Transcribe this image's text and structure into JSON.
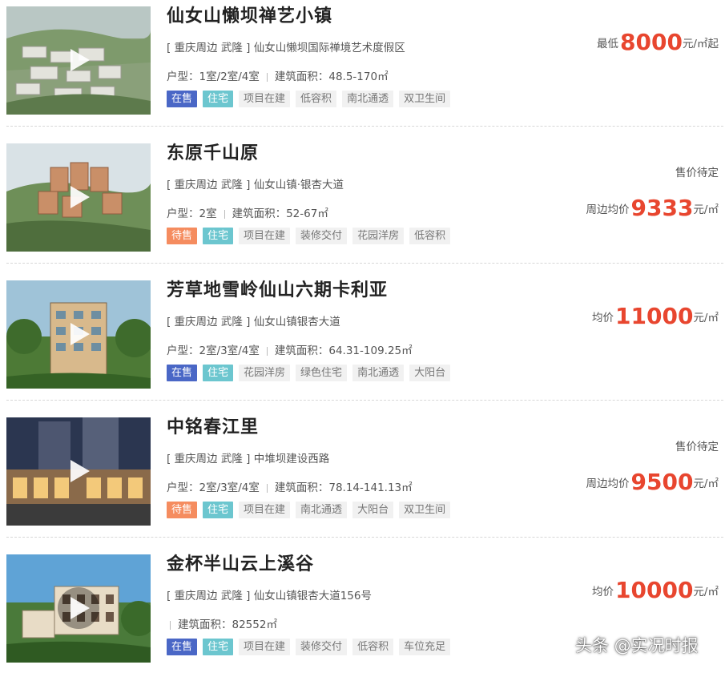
{
  "listings": [
    {
      "title": "仙女山懒坝禅艺小镇",
      "address": "[ 重庆周边 武隆 ] 仙女山懒坝国际禅境艺术度假区",
      "layout_label": "户型：",
      "layout_value": "1室/2室/4室",
      "area_label": "建筑面积：",
      "area_value": "48.5-170㎡",
      "status_tag": "在售",
      "type_tag": "住宅",
      "features": [
        "项目在建",
        "低容积",
        "南北通透",
        "双卫生间"
      ],
      "price_prefix": "最低",
      "price_value": "8000",
      "price_unit": "元/㎡起",
      "pending": ""
    },
    {
      "title": "东原千山原",
      "address": "[ 重庆周边 武隆 ] 仙女山镇·银杏大道",
      "layout_label": "户型：",
      "layout_value": "2室",
      "area_label": "建筑面积：",
      "area_value": "52-67㎡",
      "status_tag": "待售",
      "type_tag": "住宅",
      "features": [
        "项目在建",
        "装修交付",
        "花园洋房",
        "低容积"
      ],
      "price_prefix": "周边均价",
      "price_value": "9333",
      "price_unit": "元/㎡",
      "pending": "售价待定"
    },
    {
      "title": "芳草地雪岭仙山六期卡利亚",
      "address": "[ 重庆周边 武隆 ] 仙女山镇银杏大道",
      "layout_label": "户型：",
      "layout_value": "2室/3室/4室",
      "area_label": "建筑面积：",
      "area_value": "64.31-109.25㎡",
      "status_tag": "在售",
      "type_tag": "住宅",
      "features": [
        "花园洋房",
        "绿色住宅",
        "南北通透",
        "大阳台"
      ],
      "price_prefix": "均价",
      "price_value": "11000",
      "price_unit": "元/㎡",
      "pending": ""
    },
    {
      "title": "中铭春江里",
      "address": "[ 重庆周边 武隆 ] 中堆坝建设西路",
      "layout_label": "户型：",
      "layout_value": "2室/3室/4室",
      "area_label": "建筑面积：",
      "area_value": "78.14-141.13㎡",
      "status_tag": "待售",
      "type_tag": "住宅",
      "features": [
        "项目在建",
        "南北通透",
        "大阳台",
        "双卫生间"
      ],
      "price_prefix": "周边均价",
      "price_value": "9500",
      "price_unit": "元/㎡",
      "pending": "售价待定"
    },
    {
      "title": "金杯半山云上溪谷",
      "address": "[ 重庆周边 武隆 ] 仙女山镇银杏大道156号",
      "layout_label": "",
      "layout_value": "",
      "area_label": "建筑面积：",
      "area_value": "82552㎡",
      "status_tag": "在售",
      "type_tag": "住宅",
      "features": [
        "项目在建",
        "装修交付",
        "低容积",
        "车位充足"
      ],
      "price_prefix": "均价",
      "price_value": "10000",
      "price_unit": "元/㎡",
      "pending": ""
    }
  ],
  "watermark": "头条 @实况时报",
  "colors": {
    "price": "#e8462f",
    "status_on": "#4a67c6",
    "status_wait": "#f58c5f",
    "type": "#6cc6cf"
  },
  "icons": {
    "play": "play-icon"
  }
}
